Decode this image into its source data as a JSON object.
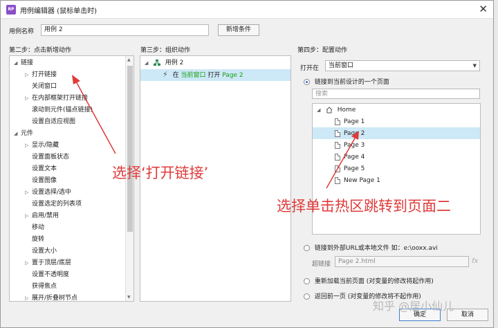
{
  "window": {
    "title": "用例编辑器 (鼠标单击时)",
    "icon_text": "RP"
  },
  "case_name": {
    "label": "用例名称",
    "value": "用例 2",
    "add_condition": "新增条件"
  },
  "step2": {
    "header": "第二步：点击新增动作",
    "groups": [
      {
        "label": "链接",
        "items": [
          {
            "label": "打开链接",
            "has_caret": true
          },
          {
            "label": "关闭窗口",
            "has_caret": false
          },
          {
            "label": "在内部框架打开链接",
            "has_caret": true
          },
          {
            "label": "滚动到元件(锚点链接)",
            "has_caret": false
          },
          {
            "label": "设置自适应视图",
            "has_caret": false
          }
        ]
      },
      {
        "label": "元件",
        "items": [
          {
            "label": "显示/隐藏",
            "has_caret": true
          },
          {
            "label": "设置面板状态",
            "has_caret": false
          },
          {
            "label": "设置文本",
            "has_caret": false
          },
          {
            "label": "设置图像",
            "has_caret": false
          },
          {
            "label": "设置选择/选中",
            "has_caret": true
          },
          {
            "label": "设置选定的列表项",
            "has_caret": false
          },
          {
            "label": "启用/禁用",
            "has_caret": true
          },
          {
            "label": "移动",
            "has_caret": false
          },
          {
            "label": "旋转",
            "has_caret": false
          },
          {
            "label": "设置大小",
            "has_caret": false
          },
          {
            "label": "置于顶层/底层",
            "has_caret": true
          },
          {
            "label": "设置不透明度",
            "has_caret": false
          },
          {
            "label": "获得焦点",
            "has_caret": false
          },
          {
            "label": "展开/折叠树节点",
            "has_caret": true
          }
        ]
      }
    ]
  },
  "step3": {
    "header": "第三步：组织动作",
    "case_label": "用例 2",
    "action": {
      "prefix": "在",
      "target": "当前窗口",
      "verb": "打开",
      "page": "Page 2"
    }
  },
  "step4": {
    "header": "第四步：配置动作",
    "open_in_label": "打开在",
    "open_in_value": "当前窗口",
    "option_current_design": "链接到当前设计的一个页面",
    "search_placeholder": "搜索",
    "pages": {
      "root": "Home",
      "children": [
        "Page 1",
        "Page 2",
        "Page 3",
        "Page 4",
        "Page 5",
        "New Page 1"
      ],
      "selected": "Page 2"
    },
    "option_external": "链接到外部URL或本地文件 如：e:\\ooxx.avi",
    "hyperlink_label": "超链接",
    "hyperlink_value": "Page 2.html",
    "fx": "fx",
    "option_reload": "重新加载当前页面 (对变量的修改将起作用)",
    "option_back": "返回前一页 (对变量的修改将不起作用)"
  },
  "buttons": {
    "ok": "确定",
    "cancel": "取消"
  },
  "annotations": {
    "left": "选择‘打开链接’",
    "right": "选择单击热区跳转到页面二",
    "color": "#e03a3a"
  },
  "watermark": "知乎 @居小仙儿",
  "colors": {
    "selection": "#cde8f6",
    "action_green": "#17a017",
    "action_blue": "#0070c0",
    "brand": "#8a4fc9"
  }
}
